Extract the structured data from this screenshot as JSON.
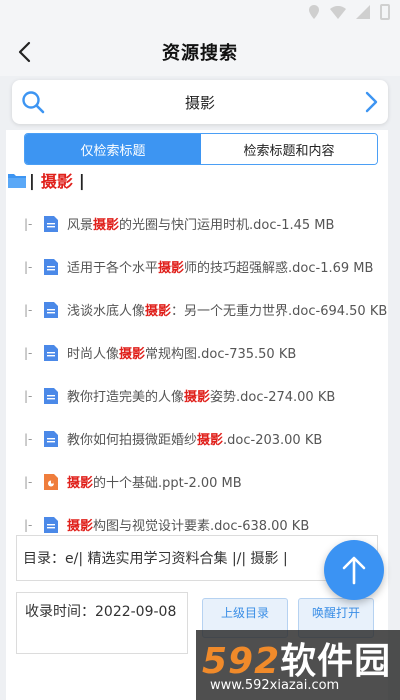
{
  "header": {
    "title": "资源搜索"
  },
  "search": {
    "query": "摄影"
  },
  "tabs": [
    {
      "label": "仅检索标题",
      "active": true
    },
    {
      "label": "检索标题和内容",
      "active": false
    }
  ],
  "folder": {
    "separator": "|",
    "keyword": "摄影"
  },
  "files": [
    {
      "tree": "|-",
      "icon": "doc-icon",
      "before": "风景",
      "keyword": "摄影",
      "after": "的光圈与快门运用时机.doc-1.45 MB"
    },
    {
      "tree": "|-",
      "icon": "doc-icon",
      "before": "适用于各个水平",
      "keyword": "摄影",
      "after": "师的技巧超强解惑.doc-1.69 MB"
    },
    {
      "tree": "|-",
      "icon": "doc-icon",
      "before": "浅谈水底人像",
      "keyword": "摄影",
      "after": "：另一个无重力世界.doc-694.50 KB"
    },
    {
      "tree": "|-",
      "icon": "doc-icon",
      "before": "时尚人像",
      "keyword": "摄影",
      "after": "常规构图.doc-735.50 KB"
    },
    {
      "tree": "|-",
      "icon": "doc-icon",
      "before": "教你打造完美的人像",
      "keyword": "摄影",
      "after": "姿势.doc-274.00 KB"
    },
    {
      "tree": "|-",
      "icon": "doc-icon",
      "before": "教你如何拍摄微距婚纱",
      "keyword": "摄影",
      "after": ".doc-203.00 KB"
    },
    {
      "tree": "|-",
      "icon": "ppt-icon",
      "before": "",
      "keyword": "摄影",
      "after": "的十个基础.ppt-2.00 MB"
    },
    {
      "tree": "|-",
      "icon": "doc-icon",
      "before": "",
      "keyword": "摄影",
      "after": "构图与视觉设计要素.doc-638.00 KB"
    }
  ],
  "detail": {
    "path": "目录：e/| 精选实用学习资料合集 |/| 摄影 |",
    "time_label": "收录时间：2022-09-08",
    "btn_up": "上级目录",
    "btn_wake": "唤醒打开"
  },
  "watermark": {
    "num": "592",
    "cn": "软件园",
    "url": "www.592xiazai.com"
  },
  "colors": {
    "accent": "#3d95f2",
    "highlight": "#e0211c",
    "ppt": "#ef7d3c"
  }
}
